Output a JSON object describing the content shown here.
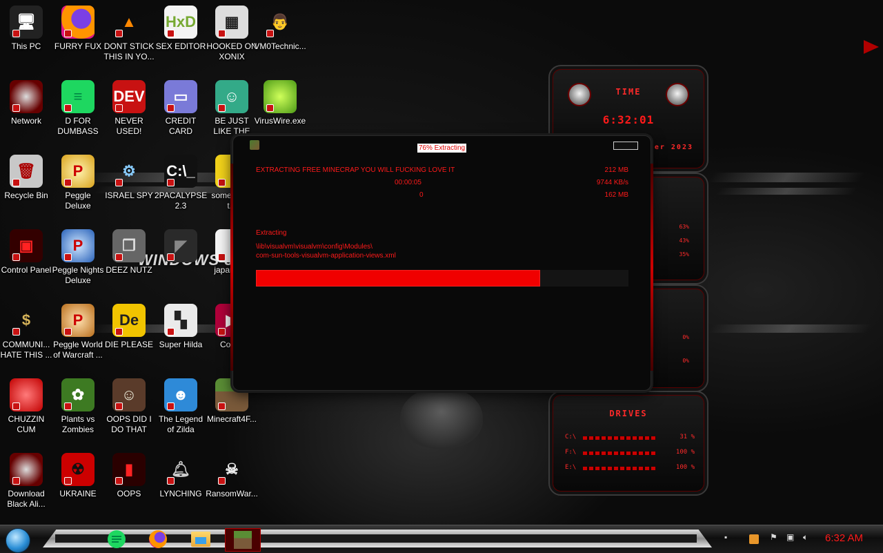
{
  "desktop": {
    "icons": [
      {
        "label": "This PC",
        "icon": "pc-icon"
      },
      {
        "label": "FURRY FUX",
        "icon": "firefox-icon"
      },
      {
        "label": "DONT STICK THIS IN YO...",
        "icon": "vlc-cone-icon"
      },
      {
        "label": "SEX EDITOR",
        "icon": "hxd-editor-icon"
      },
      {
        "label": "HOOKED ON XONIX",
        "icon": "xonix-game-icon"
      },
      {
        "label": "VM0Technic...",
        "icon": "doctor-icon"
      },
      {
        "label": "Network",
        "icon": "alien-network-icon"
      },
      {
        "label": "D FOR DUMBASS",
        "icon": "green-chat-icon"
      },
      {
        "label": "NEVER USED!",
        "icon": "devcpp-icon"
      },
      {
        "label": "CREDIT CARD CHECKER",
        "icon": "credit-card-icon"
      },
      {
        "label": "BE JUST LIKE THE DUDE!",
        "icon": "santa-icon"
      },
      {
        "label": "VirusWire.exe",
        "icon": "limewire-icon"
      },
      {
        "label": "Recycle Bin",
        "icon": "recycle-bin-icon"
      },
      {
        "label": "Peggle Deluxe",
        "icon": "peggle-icon"
      },
      {
        "label": "ISRAEL SPY",
        "icon": "network-spy-icon"
      },
      {
        "label": "2PACALYPSE 2.3",
        "icon": "terminal-icon"
      },
      {
        "label": "some need t...",
        "icon": "yellow-icon"
      },
      {
        "label": "Control Panel",
        "icon": "control-panel-icon"
      },
      {
        "label": "Peggle Nights Deluxe",
        "icon": "peggle-nights-icon"
      },
      {
        "label": "DEEZ NUTZ",
        "icon": "stacked-windows-icon"
      },
      {
        "label": "",
        "icon": "dark-app-icon"
      },
      {
        "label": "japan si...",
        "icon": "document-icon"
      },
      {
        "label": "COMMUNI... HATE THIS ...",
        "icon": "money-bag-icon"
      },
      {
        "label": "Peggle World of Warcraft ...",
        "icon": "peggle-wow-icon"
      },
      {
        "label": "DIE PLEASE",
        "icon": "de-icon"
      },
      {
        "label": "Super Hilda",
        "icon": "pixel-dog-icon"
      },
      {
        "label": "Collab",
        "icon": "collab-icon"
      },
      {
        "label": "CHUZZIN CUM",
        "icon": "chuzzle-icon"
      },
      {
        "label": "Plants vs Zombies",
        "icon": "plants-vs-zombies-icon"
      },
      {
        "label": "OOPS DID I DO THAT",
        "icon": "portrait-icon"
      },
      {
        "label": "The Legend of Zilda",
        "icon": "pixel-hero-icon"
      },
      {
        "label": "Minecraft4F...",
        "icon": "minecraft-icon"
      },
      {
        "label": "Download Black Ali...",
        "icon": "alien-download-icon"
      },
      {
        "label": "UKRAINE",
        "icon": "radiation-icon"
      },
      {
        "label": "OOPS",
        "icon": "red-book-icon"
      },
      {
        "label": "LYNCHING",
        "icon": "bell-icon"
      },
      {
        "label": "RansomWar...",
        "icon": "skull-icon"
      }
    ],
    "wallpaper_text": "WINDOWS 8"
  },
  "gadget": {
    "time_title": "TIME",
    "time": "6:32:01",
    "date_fragment": "ber 2023",
    "cpu_pcts": [
      "63%",
      "43%",
      "35%"
    ],
    "net_pcts": [
      "0%",
      "0%"
    ],
    "drives_title": "DRIVES",
    "drives": [
      {
        "letter": "C:\\",
        "pct": "31 %"
      },
      {
        "letter": "F:\\",
        "pct": "100 %"
      },
      {
        "letter": "E:\\",
        "pct": "100 %"
      }
    ]
  },
  "dialog": {
    "title": "76% Extracting",
    "progress": 0.76,
    "message": "EXTRACTING FREE MINECRAP YOU WILL FUCKING LOVE IT",
    "elapsed": "00:00:05",
    "remaining": "0",
    "size_total": "212 MB",
    "speed": "9744 KB/s",
    "size_done": "162 MB",
    "status_label": "Extracting",
    "path_line1": "\\lib\\visualvm\\visualvm\\config\\Modules\\",
    "path_line2": "com-sun-tools-visualvm-application-views.xml"
  },
  "taskbar": {
    "apps": [
      "green-chat-icon",
      "firefox-icon",
      "file-explorer-icon",
      "minecraft-icon"
    ],
    "tray_icons": [
      "show-hidden-icon",
      "app-tray-icon",
      "flag-icon",
      "network-icon",
      "volume-icon"
    ],
    "clock": "6:32 AM"
  },
  "colors": {
    "accent": "#ff1a1a",
    "progress": "#f00000",
    "background": "#0b0b0b"
  }
}
